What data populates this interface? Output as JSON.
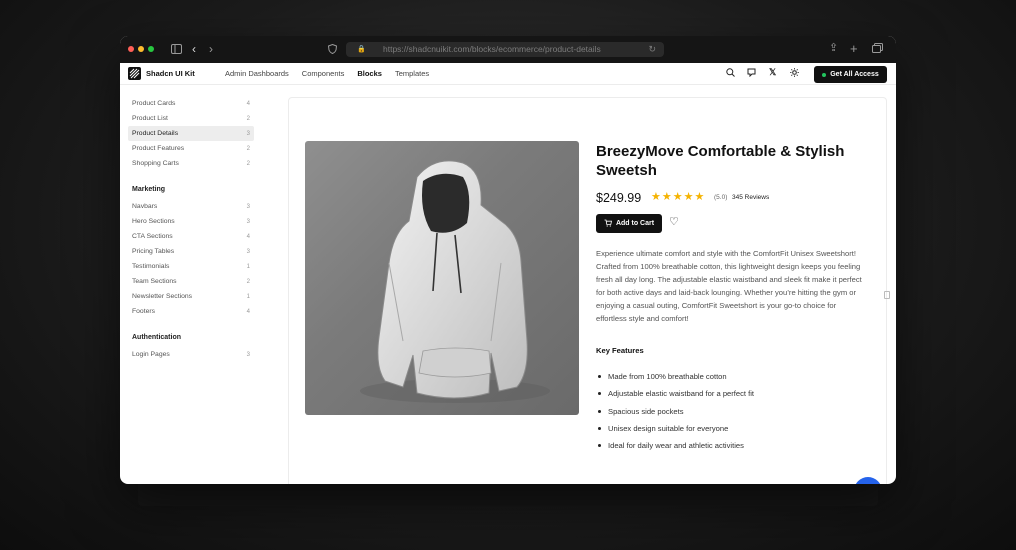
{
  "browser": {
    "url": "https://shadcnuikit.com/blocks/ecommerce/product-details",
    "traffic_colors": [
      "#ff5f57",
      "#febc2e",
      "#28c840"
    ]
  },
  "header": {
    "brand": "Shadcn UI Kit",
    "nav": [
      "Admin Dashboards",
      "Components",
      "Blocks",
      "Templates"
    ],
    "active_nav": "Blocks",
    "cta_label": "Get All Access"
  },
  "sidebar": {
    "items": [
      {
        "label": "Product Cards",
        "count": "4"
      },
      {
        "label": "Product List",
        "count": "2"
      },
      {
        "label": "Product Details",
        "count": "3",
        "active": true
      },
      {
        "label": "Product Features",
        "count": "2"
      },
      {
        "label": "Shopping Carts",
        "count": "2"
      }
    ],
    "marketing_heading": "Marketing",
    "marketing": [
      {
        "label": "Navbars",
        "count": "3"
      },
      {
        "label": "Hero Sections",
        "count": "3"
      },
      {
        "label": "CTA Sections",
        "count": "4"
      },
      {
        "label": "Pricing Tables",
        "count": "3"
      },
      {
        "label": "Testimonials",
        "count": "1"
      },
      {
        "label": "Team Sections",
        "count": "2"
      },
      {
        "label": "Newsletter Sections",
        "count": "1"
      },
      {
        "label": "Footers",
        "count": "4"
      }
    ],
    "auth_heading": "Authentication",
    "auth": [
      {
        "label": "Login Pages",
        "count": "3"
      }
    ]
  },
  "product": {
    "title": "BreezyMove Comfortable & Stylish Sweetsh",
    "price": "$249.99",
    "rating_value": 5,
    "rating_text": "(5.0)",
    "reviews": "345 Reviews",
    "add_to_cart": "Add to Cart",
    "description": "Experience ultimate comfort and style with the ComfortFit Unisex Sweetshort! Crafted from 100% breathable cotton, this lightweight design keeps you feeling fresh all day long. The adjustable elastic waistband and sleek fit make it perfect for both active days and laid-back lounging. Whether you’re hitting the gym or enjoying a casual outing, ComfortFit Sweetshort is your go-to choice for effortless style and comfort!",
    "key_features_heading": "Key Features",
    "features": [
      "Made from 100% breathable cotton",
      "Adjustable elastic waistband for a perfect fit",
      "Spacious side pockets",
      "Unisex design suitable for everyone",
      "Ideal for daily wear and athletic activities"
    ]
  },
  "colors": {
    "accent": "#111111",
    "star": "#f5b301",
    "fab": "#2563eb"
  }
}
